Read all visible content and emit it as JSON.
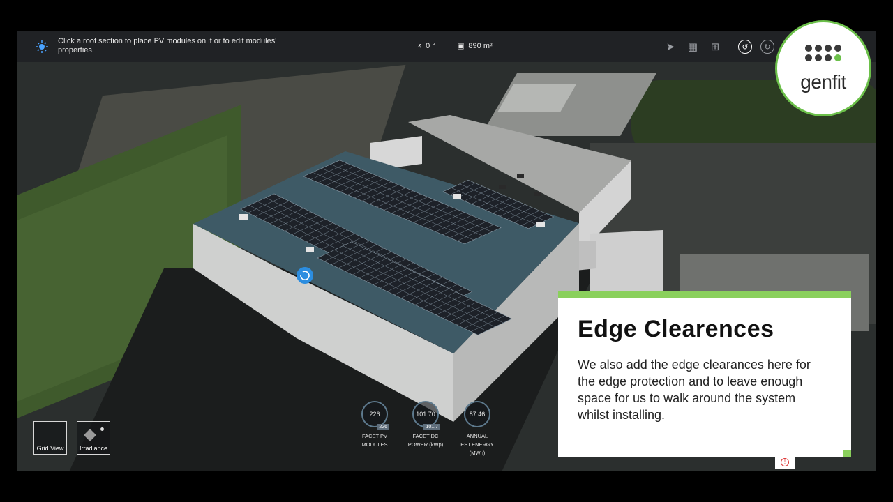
{
  "toolbar": {
    "hint": "Click a roof section to place PV modules on it or to edit modules' properties.",
    "angle": "0 °",
    "area": "890 m²"
  },
  "logo": {
    "text": "genfit"
  },
  "card": {
    "title": "Edge Clearences",
    "body": "We also add the edge clearances here for the edge protection and to leave enough space for us to walk around the system whilst installing."
  },
  "metrics": [
    {
      "value": "226",
      "sub": "226",
      "label1": "FACET PV",
      "label2": "MODULES",
      "label3": ""
    },
    {
      "value": "101.70",
      "sub": "101.7",
      "label1": "FACET DC",
      "label2": "POWER (kWp)",
      "label3": ""
    },
    {
      "value": "87.46",
      "sub": "",
      "label1": "ANNUAL",
      "label2": "EST.ENERGY",
      "label3": "(MWh)"
    }
  ],
  "view_buttons": {
    "grid": "Grid View",
    "irradiance": "Irradiance"
  },
  "colors": {
    "accent": "#8ad05c",
    "roof": "#3e5a66",
    "panel": "#1d2128",
    "wall": "#c8c8c8"
  },
  "icons": [
    "sun-icon",
    "angle-icon",
    "area-icon",
    "pointer-icon",
    "add-grid-icon",
    "layout-icon",
    "undo-icon",
    "redo-icon",
    "rotate-handle-icon",
    "warning-icon"
  ]
}
